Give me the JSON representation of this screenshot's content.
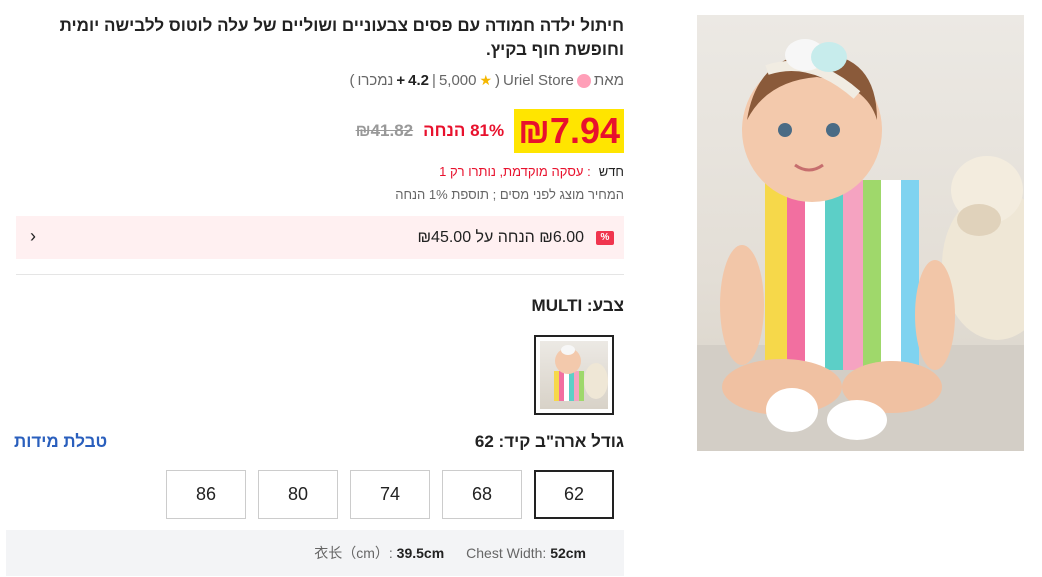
{
  "product": {
    "title": "חיתול ילדה חמודה עם פסים צבעוניים ושוליים של עלה לוטוס ללבישה יומית וחופשת חוף בקיץ.",
    "by_label": "מאת",
    "store_name": "Uriel Store",
    "sold_count": "5,000",
    "rating": "4.2",
    "rating_suffix": "+",
    "sold_label": "נמכרו",
    "open_paren": "(",
    "close_paren": ")",
    "separator": "|"
  },
  "price": {
    "current": "₪7.94",
    "discount": "81% הנחה",
    "original": "₪41.82"
  },
  "deal": {
    "new_label": "חדש",
    "colon": ":",
    "text": "עסקה מוקדמת, נותרו רק 1"
  },
  "tax_note": "המחיר מוצג לפני מסים ; תוספת 1% הנחה",
  "coupon": {
    "icon_symbol": "%",
    "text": "₪6.00 הנחה על ₪45.00",
    "chevron": "‹"
  },
  "color": {
    "label": "צבע: MULTI"
  },
  "size": {
    "label": "גודל ארה\"ב קיד: 62",
    "chart_link": "טבלת מידות",
    "options": [
      "62",
      "68",
      "74",
      "80",
      "86"
    ],
    "selected": "62"
  },
  "measurements": {
    "chest_label": "Chest Width:",
    "chest_value": "52cm",
    "length_label": "衣长（cm）:",
    "length_value": "39.5cm"
  },
  "colors": {
    "accent_red": "#e8112d",
    "price_highlight": "#ffe500",
    "link_blue": "#2a5fbd",
    "coupon_bg": "#fff0f1"
  }
}
